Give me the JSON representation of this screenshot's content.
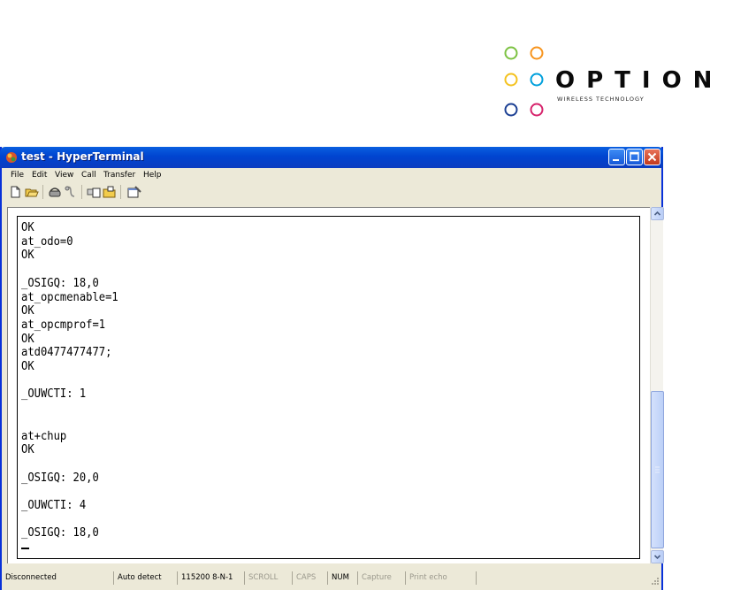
{
  "logo": {
    "word": "OPTION",
    "tagline": "WIRELESS TECHNOLOGY",
    "circle_colors": [
      "#7cc242",
      "#f7941d",
      "#f4c21f",
      "#00a0dc",
      "#1b3f93",
      "#d6226b"
    ]
  },
  "window": {
    "title": "test - HyperTerminal",
    "icon": "hyperterminal-icon"
  },
  "menu": [
    {
      "label": "File"
    },
    {
      "label": "Edit"
    },
    {
      "label": "View"
    },
    {
      "label": "Call"
    },
    {
      "label": "Transfer"
    },
    {
      "label": "Help"
    }
  ],
  "toolbar": [
    "new-icon",
    "open-icon",
    "connect-icon",
    "disconnect-icon",
    "send-icon",
    "receive-icon",
    "properties-icon"
  ],
  "terminal": {
    "text": "OK\nat_odo=0\nOK\n\n_OSIGQ: 18,0\nat_opcmenable=1\nOK\nat_opcmprof=1\nOK\natd0477477477;\nOK\n\n_OUWCTI: 1\n\n\nat+chup\nOK\n\n_OSIGQ: 20,0\n\n_OUWCTI: 4\n\n_OSIGQ: 18,0"
  },
  "status": {
    "connection": "Disconnected",
    "detect": "Auto detect",
    "settings": "115200 8-N-1",
    "scroll": "SCROLL",
    "caps": "CAPS",
    "num": "NUM",
    "capture": "Capture",
    "print_echo": "Print echo"
  }
}
